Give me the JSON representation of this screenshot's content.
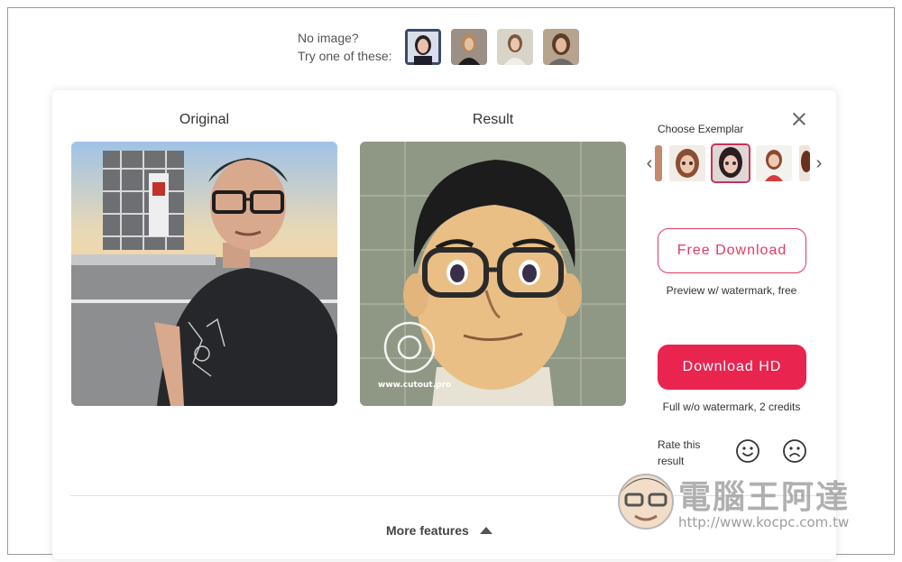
{
  "samples": {
    "line1": "No image?",
    "line2": "Try one of these:",
    "thumbs": [
      "sample-portrait-1",
      "sample-portrait-2",
      "sample-portrait-3",
      "sample-portrait-4"
    ]
  },
  "card": {
    "original_title": "Original",
    "result_title": "Result",
    "result_watermark": "www.cutout.pro",
    "exemplar_title": "Choose Exemplar",
    "free_download_label": "Free Download",
    "free_download_note": "Preview w/ watermark, free",
    "download_hd_label": "Download HD",
    "download_hd_note": "Full w/o watermark, 2 credits",
    "rate_label": "Rate this result",
    "more_features_label": "More features"
  },
  "watermark": {
    "cn_text": "電腦王阿達",
    "url": "http://www.kocpc.com.tw"
  },
  "colors": {
    "accent": "#e8244f",
    "accent_outline": "#e03a63",
    "selected_border": "#c8345a"
  },
  "icons": [
    "close-icon",
    "chevron-left-icon",
    "chevron-right-icon",
    "smile-icon",
    "frown-icon",
    "triangle-up-icon"
  ]
}
